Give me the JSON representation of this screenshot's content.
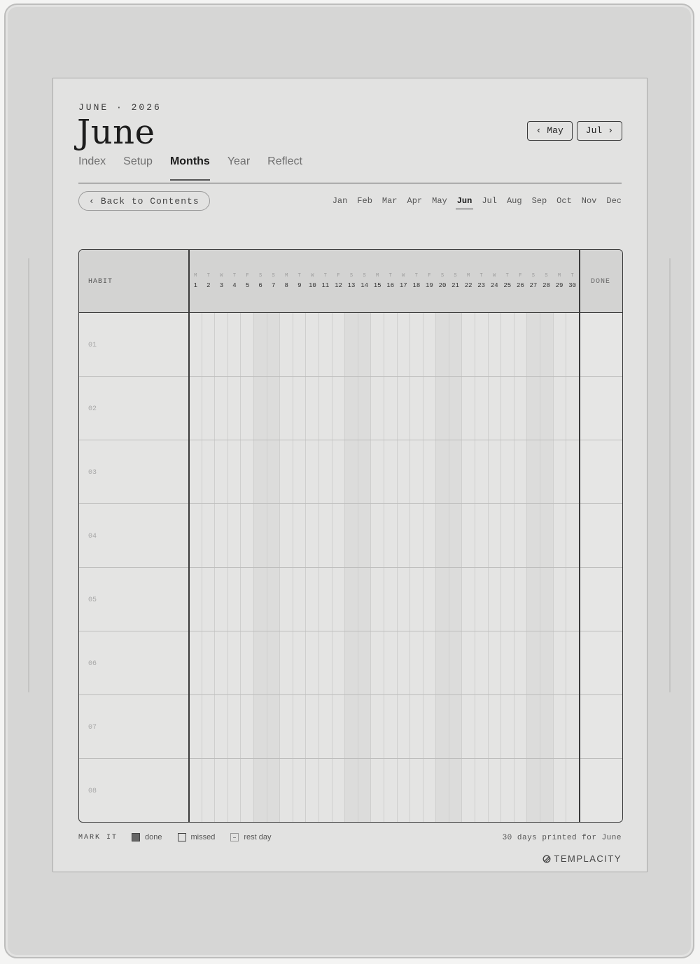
{
  "header": {
    "kicker": "JUNE · 2026",
    "title": "June",
    "prev_button": {
      "arrow": "‹",
      "label": "May"
    },
    "next_button": {
      "label": "Jul",
      "arrow": "›"
    }
  },
  "tabs": [
    {
      "label": "Index",
      "active": false
    },
    {
      "label": "Setup",
      "active": false
    },
    {
      "label": "Months",
      "active": true
    },
    {
      "label": "Year",
      "active": false
    },
    {
      "label": "Reflect",
      "active": false
    }
  ],
  "back_button": {
    "arrow": "‹",
    "label": "Back to Contents"
  },
  "months": [
    {
      "label": "Jan",
      "active": false
    },
    {
      "label": "Feb",
      "active": false
    },
    {
      "label": "Mar",
      "active": false
    },
    {
      "label": "Apr",
      "active": false
    },
    {
      "label": "May",
      "active": false
    },
    {
      "label": "Jun",
      "active": true
    },
    {
      "label": "Jul",
      "active": false
    },
    {
      "label": "Aug",
      "active": false
    },
    {
      "label": "Sep",
      "active": false
    },
    {
      "label": "Oct",
      "active": false
    },
    {
      "label": "Nov",
      "active": false
    },
    {
      "label": "Dec",
      "active": false
    }
  ],
  "grid": {
    "habit_header": "HABIT",
    "done_header": "DONE",
    "days": [
      {
        "dow": "M",
        "num": "1"
      },
      {
        "dow": "T",
        "num": "2"
      },
      {
        "dow": "W",
        "num": "3"
      },
      {
        "dow": "T",
        "num": "4"
      },
      {
        "dow": "F",
        "num": "5"
      },
      {
        "dow": "S",
        "num": "6"
      },
      {
        "dow": "S",
        "num": "7"
      },
      {
        "dow": "M",
        "num": "8"
      },
      {
        "dow": "T",
        "num": "9"
      },
      {
        "dow": "W",
        "num": "10"
      },
      {
        "dow": "T",
        "num": "11"
      },
      {
        "dow": "F",
        "num": "12"
      },
      {
        "dow": "S",
        "num": "13"
      },
      {
        "dow": "S",
        "num": "14"
      },
      {
        "dow": "M",
        "num": "15"
      },
      {
        "dow": "T",
        "num": "16"
      },
      {
        "dow": "W",
        "num": "17"
      },
      {
        "dow": "T",
        "num": "18"
      },
      {
        "dow": "F",
        "num": "19"
      },
      {
        "dow": "S",
        "num": "20"
      },
      {
        "dow": "S",
        "num": "21"
      },
      {
        "dow": "M",
        "num": "22"
      },
      {
        "dow": "T",
        "num": "23"
      },
      {
        "dow": "W",
        "num": "24"
      },
      {
        "dow": "T",
        "num": "25"
      },
      {
        "dow": "F",
        "num": "26"
      },
      {
        "dow": "S",
        "num": "27"
      },
      {
        "dow": "S",
        "num": "28"
      },
      {
        "dow": "M",
        "num": "29"
      },
      {
        "dow": "T",
        "num": "30"
      }
    ],
    "rows": [
      "01",
      "02",
      "03",
      "04",
      "05",
      "06",
      "07",
      "08"
    ]
  },
  "legend": {
    "label": "MARK IT",
    "items": [
      {
        "kind": "done",
        "label": "done"
      },
      {
        "kind": "missed",
        "label": "missed"
      },
      {
        "kind": "rest",
        "label": "rest day"
      }
    ]
  },
  "footer": {
    "printed": "30 days printed for June",
    "brand": "TEMPLACITY"
  }
}
